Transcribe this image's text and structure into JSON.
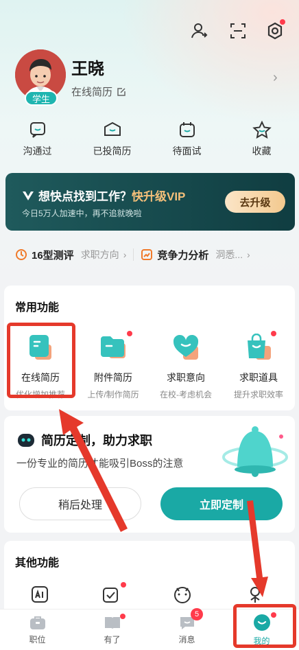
{
  "profile": {
    "name": "王晓",
    "badge": "学生",
    "resume_link": "在线简历"
  },
  "stats": [
    {
      "label": "沟通过",
      "icon": "chat-icon"
    },
    {
      "label": "已投简历",
      "icon": "briefcase-icon"
    },
    {
      "label": "待面试",
      "icon": "calendar-icon"
    },
    {
      "label": "收藏",
      "icon": "star-icon"
    }
  ],
  "vip": {
    "title_prefix": "想快点找到工作？",
    "title_highlight": "快升级VIP",
    "subtitle": "今日5万人加速中，再不追就晚啦",
    "button": "去升级"
  },
  "tests": {
    "item1_label": "16型测评",
    "item1_sub": "求职方向",
    "item2_label": "竞争力分析",
    "item2_sub": "洞悉..."
  },
  "common": {
    "title": "常用功能",
    "items": [
      {
        "label": "在线简历",
        "sub": "优化增加推荐"
      },
      {
        "label": "附件简历",
        "sub": "上传/制作简历"
      },
      {
        "label": "求职意向",
        "sub": "在校-考虑机会"
      },
      {
        "label": "求职道具",
        "sub": "提升求职效率"
      }
    ]
  },
  "custom": {
    "title": "简历定制，助力求职",
    "subtitle": "一份专业的简历才能吸引Boss的注意",
    "later": "稍后处理",
    "now": "立即定制"
  },
  "other": {
    "title": "其他功能"
  },
  "tabbar": {
    "items": [
      {
        "label": "职位"
      },
      {
        "label": "有了"
      },
      {
        "label": "消息",
        "badge": "5"
      },
      {
        "label": "我的"
      }
    ]
  },
  "colors": {
    "accent": "#1aa9a5",
    "highlight_red": "#e5392b",
    "vip_gold": "#f6c07a"
  }
}
